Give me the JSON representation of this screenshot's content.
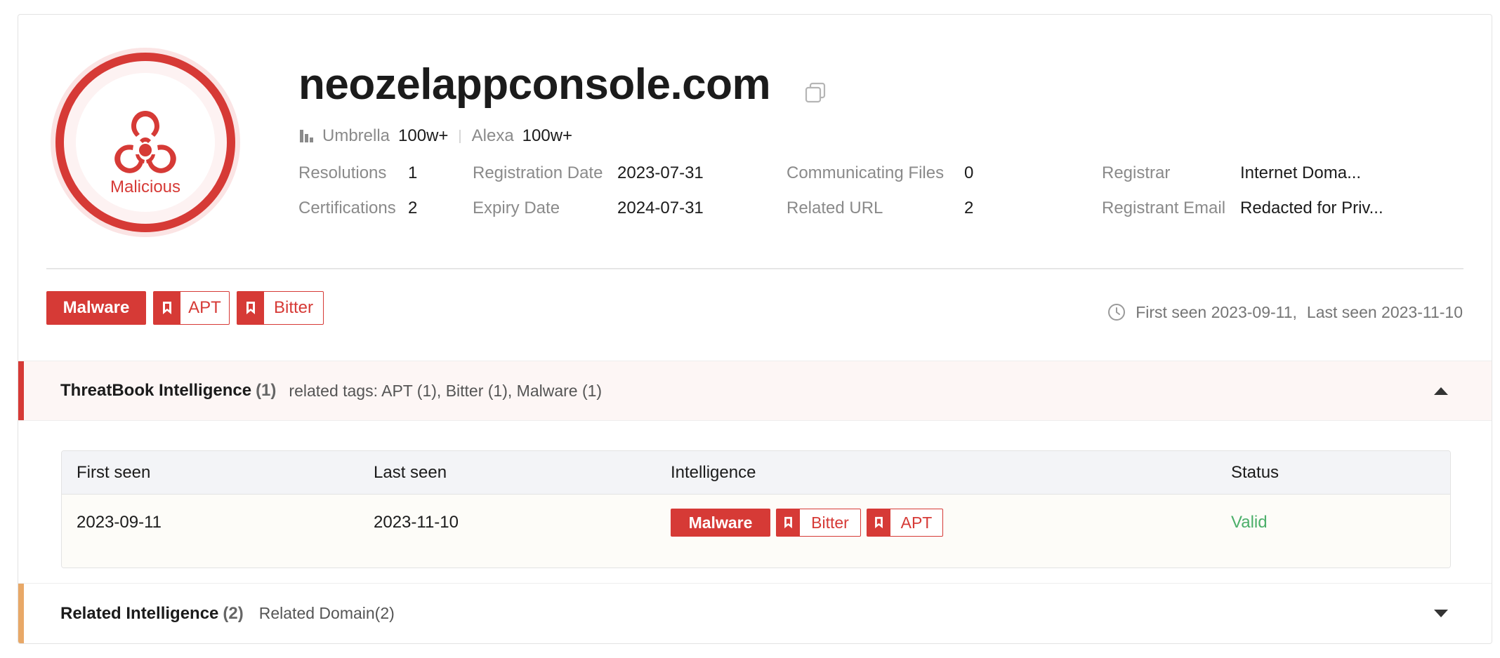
{
  "verdict": {
    "label": "Malicious",
    "icon": "biohazard-icon",
    "color": "#d63a36"
  },
  "domain": "neozelappconsole.com",
  "ranks": [
    {
      "label": "Umbrella",
      "value": "100w+"
    },
    {
      "label": "Alexa",
      "value": "100w+"
    }
  ],
  "info": {
    "resolutions": {
      "label": "Resolutions",
      "value": "1"
    },
    "certifications": {
      "label": "Certifications",
      "value": "2"
    },
    "registration_date": {
      "label": "Registration Date",
      "value": "2023-07-31"
    },
    "expiry_date": {
      "label": "Expiry Date",
      "value": "2024-07-31"
    },
    "communicating_files": {
      "label": "Communicating Files",
      "value": "0"
    },
    "related_url": {
      "label": "Related URL",
      "value": "2"
    },
    "registrar": {
      "label": "Registrar",
      "value": "Internet Doma..."
    },
    "registrant_email": {
      "label": "Registrant Email",
      "value": "Redacted for Priv..."
    }
  },
  "tags": {
    "malware": "Malware",
    "apt": "APT",
    "bitter": "Bitter"
  },
  "seen": {
    "first": "First seen 2023-09-11,",
    "last": "Last seen 2023-11-10"
  },
  "threatbook": {
    "title": "ThreatBook Intelligence",
    "count": "(1)",
    "related_tags": "related tags: APT (1), Bitter (1), Malware (1)",
    "accent": "#d63a36",
    "columns": [
      "First seen",
      "Last seen",
      "Intelligence",
      "Status"
    ],
    "rows": [
      {
        "first_seen": "2023-09-11",
        "last_seen": "2023-11-10",
        "tags": [
          "Malware",
          "Bitter",
          "APT"
        ],
        "status": "Valid"
      }
    ]
  },
  "related": {
    "title": "Related Intelligence",
    "count": "(2)",
    "sub": "Related Domain(2)",
    "accent": "#e8a867"
  }
}
